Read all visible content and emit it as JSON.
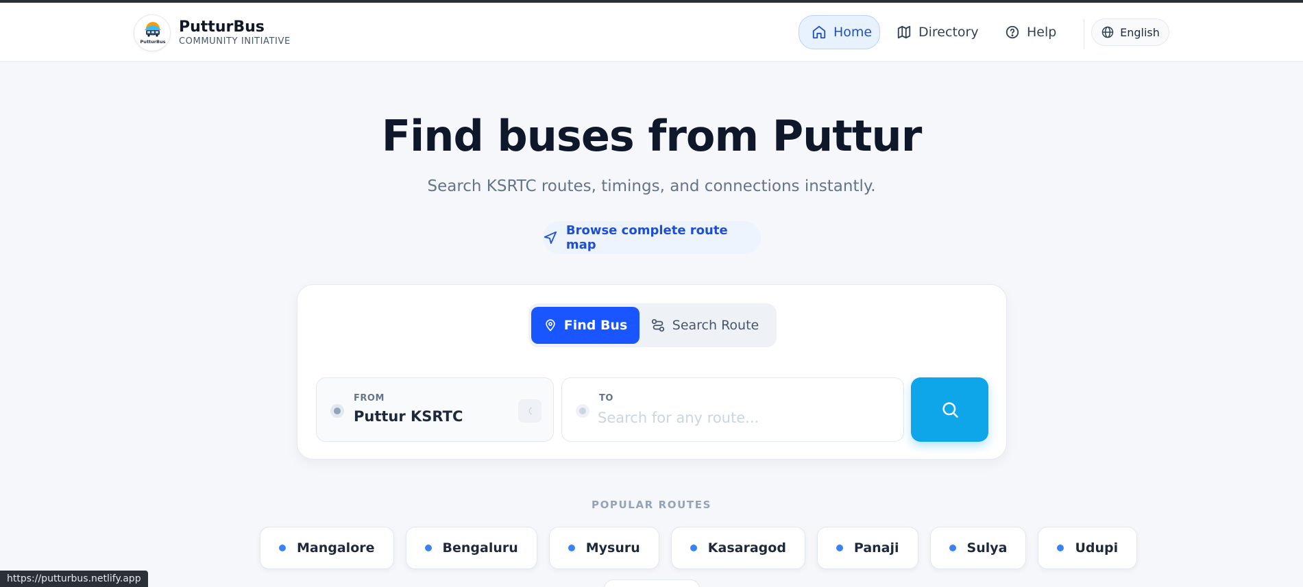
{
  "header": {
    "brand_name": "PutturBus",
    "brand_sub": "COMMUNITY INITIATIVE",
    "logo_text": "PutturBus",
    "nav": [
      {
        "label": "Home",
        "icon": "home-icon"
      },
      {
        "label": "Directory",
        "icon": "map-icon"
      },
      {
        "label": "Help",
        "icon": "help-circle-icon"
      }
    ],
    "language": "English"
  },
  "hero": {
    "title": "Find buses from Puttur",
    "subtitle": "Search KSRTC routes, timings, and connections instantly.",
    "browse_label": "Browse complete route map"
  },
  "search": {
    "tabs": [
      {
        "label": "Find Bus",
        "icon": "map-pin-icon",
        "active": true
      },
      {
        "label": "Search Route",
        "icon": "route-icon",
        "active": false
      }
    ],
    "from_label": "FROM",
    "from_value": "Puttur KSRTC",
    "to_label": "TO",
    "to_placeholder": "Search for any route..."
  },
  "popular": {
    "title": "POPULAR ROUTES",
    "routes": [
      "Mangalore",
      "Bengaluru",
      "Mysuru",
      "Kasaragod",
      "Panaji",
      "Sulya",
      "Udupi"
    ]
  },
  "status_url": "https://putturbus.netlify.app",
  "colors": {
    "primary": "#1a56ff",
    "search_button": "#0ea5e9",
    "nav_active_bg": "#e8f1fe",
    "route_dot": "#3b82f6"
  }
}
